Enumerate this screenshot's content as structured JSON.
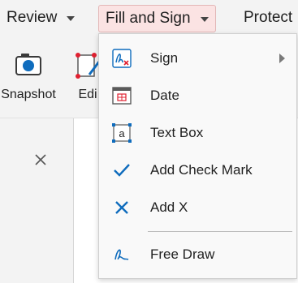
{
  "menubar": {
    "review_label": "Review",
    "fill_sign_label": "Fill and Sign",
    "protect_label": "Protect"
  },
  "ribbon": {
    "snapshot_label": "Snapshot",
    "edit_label": "Edi"
  },
  "dropdown": {
    "items": [
      {
        "label": "Sign",
        "icon": "signature-icon",
        "has_submenu": true
      },
      {
        "label": "Date",
        "icon": "calendar-icon"
      },
      {
        "label": "Text Box",
        "icon": "text-box-icon"
      },
      {
        "label": "Add Check Mark",
        "icon": "check-icon"
      },
      {
        "label": "Add X",
        "icon": "x-mark-icon"
      },
      {
        "label": "Free Draw",
        "icon": "pen-draw-icon"
      }
    ]
  },
  "colors": {
    "accent": "#0f6cbd",
    "active_menu_bg": "#fbe3e3",
    "sign_red": "#e02030"
  }
}
